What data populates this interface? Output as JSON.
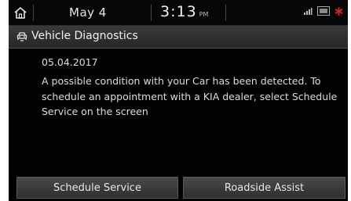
{
  "statusbar": {
    "date": "May 4",
    "time": "3:13",
    "ampm": "PM",
    "icons": [
      "home-icon",
      "signal-icon",
      "lte-icon",
      "bluetooth-icon"
    ]
  },
  "header": {
    "title": "Vehicle Diagnostics",
    "icon": "car-diagnostics-icon"
  },
  "message": {
    "date": "05.04.2017",
    "body": "A possible condition with your Car has been detected. To schedule an appointment with a KIA dealer, select Schedule Service on the screen"
  },
  "buttons": {
    "schedule": "Schedule Service",
    "roadside": "Roadside Assist"
  },
  "colors": {
    "background": "#000000",
    "bluetooth": "#e02020"
  }
}
